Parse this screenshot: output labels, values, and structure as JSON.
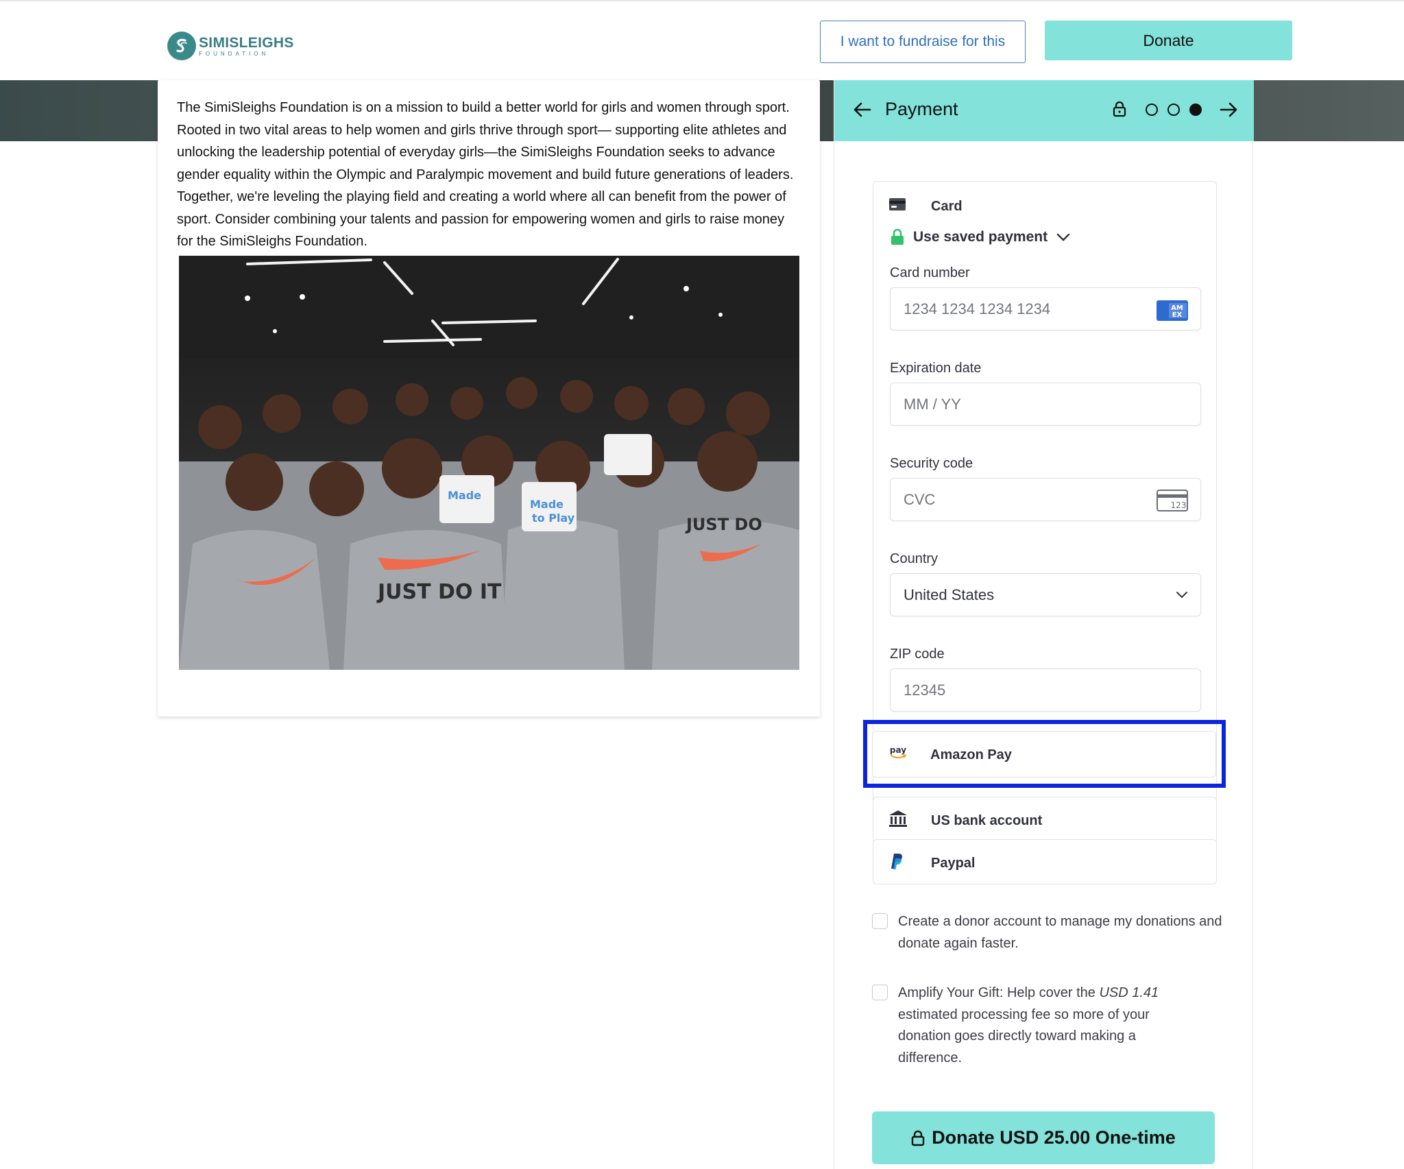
{
  "header": {
    "logo_name": "SIMISLEIGHS",
    "logo_sub": "FOUNDATION",
    "fundraise_label": "I want to fundraise for this",
    "donate_label": "Donate"
  },
  "story": {
    "text": "The SimiSleighs Foundation is on a mission to build a better world for girls and women through sport. Rooted in two vital areas to help women and girls thrive through sport— supporting elite athletes and unlocking the leadership potential of everyday girls—the SimiSleighs Foundation seeks to advance gender equality within the Olympic and Paralympic movement and build future generations of leaders. Together, we're leveling the playing field and creating a world where all can benefit from the power of sport. Consider combining your talents and passion for empowering women and girls to raise money for the SimiSleighs Foundation.",
    "photo_icon": "group-photo"
  },
  "payment": {
    "title": "Payment",
    "step_current": 3,
    "step_total": 3,
    "methods": {
      "card": "Card",
      "amazon": "Amazon Pay",
      "amazon_badge": "pay",
      "bank": "US bank account",
      "paypal": "Paypal"
    },
    "saved_payment": "Use saved payment",
    "fields": {
      "card_number": {
        "label": "Card number",
        "placeholder": "1234 1234 1234 1234",
        "badge": "AM EX"
      },
      "expiry": {
        "label": "Expiration date",
        "placeholder": "MM / YY"
      },
      "cvc": {
        "label": "Security code",
        "placeholder": "CVC",
        "badge": "123"
      },
      "country": {
        "label": "Country",
        "value": "United States"
      },
      "zip": {
        "label": "ZIP code",
        "placeholder": "12345"
      }
    },
    "checkboxes": {
      "donor_account": "Create a donor account to manage my donations and donate again faster.",
      "amplify_prefix": "Amplify Your Gift: Help cover the ",
      "amplify_amount": "USD 1.41",
      "amplify_suffix": " estimated processing fee so more of your donation goes directly toward making a difference."
    },
    "submit_label": "Donate USD 25.00 One-time"
  },
  "colors": {
    "accent": "#83e2da",
    "link_blue": "#2f6fba",
    "highlight": "#0a24e0"
  }
}
